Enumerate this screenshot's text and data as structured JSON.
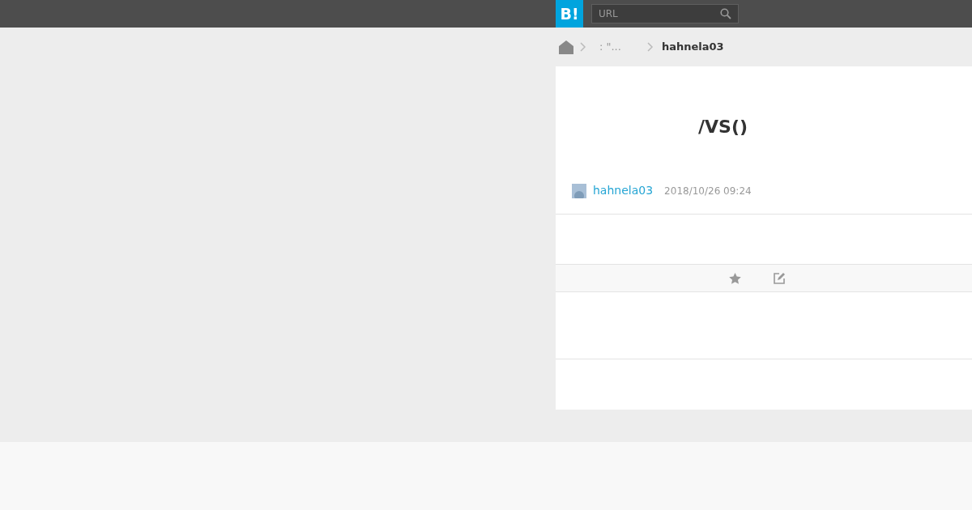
{
  "header": {
    "logo": "B!",
    "search": {
      "placeholder": "URL"
    }
  },
  "breadcrumb": [
    {
      "label": ": \"...",
      "current": false
    },
    {
      "label": "hahnela03",
      "current": true
    }
  ],
  "entry": {
    "title": "/VS()",
    "user": "hahnela03",
    "date": "2018/10/26 09:24"
  }
}
